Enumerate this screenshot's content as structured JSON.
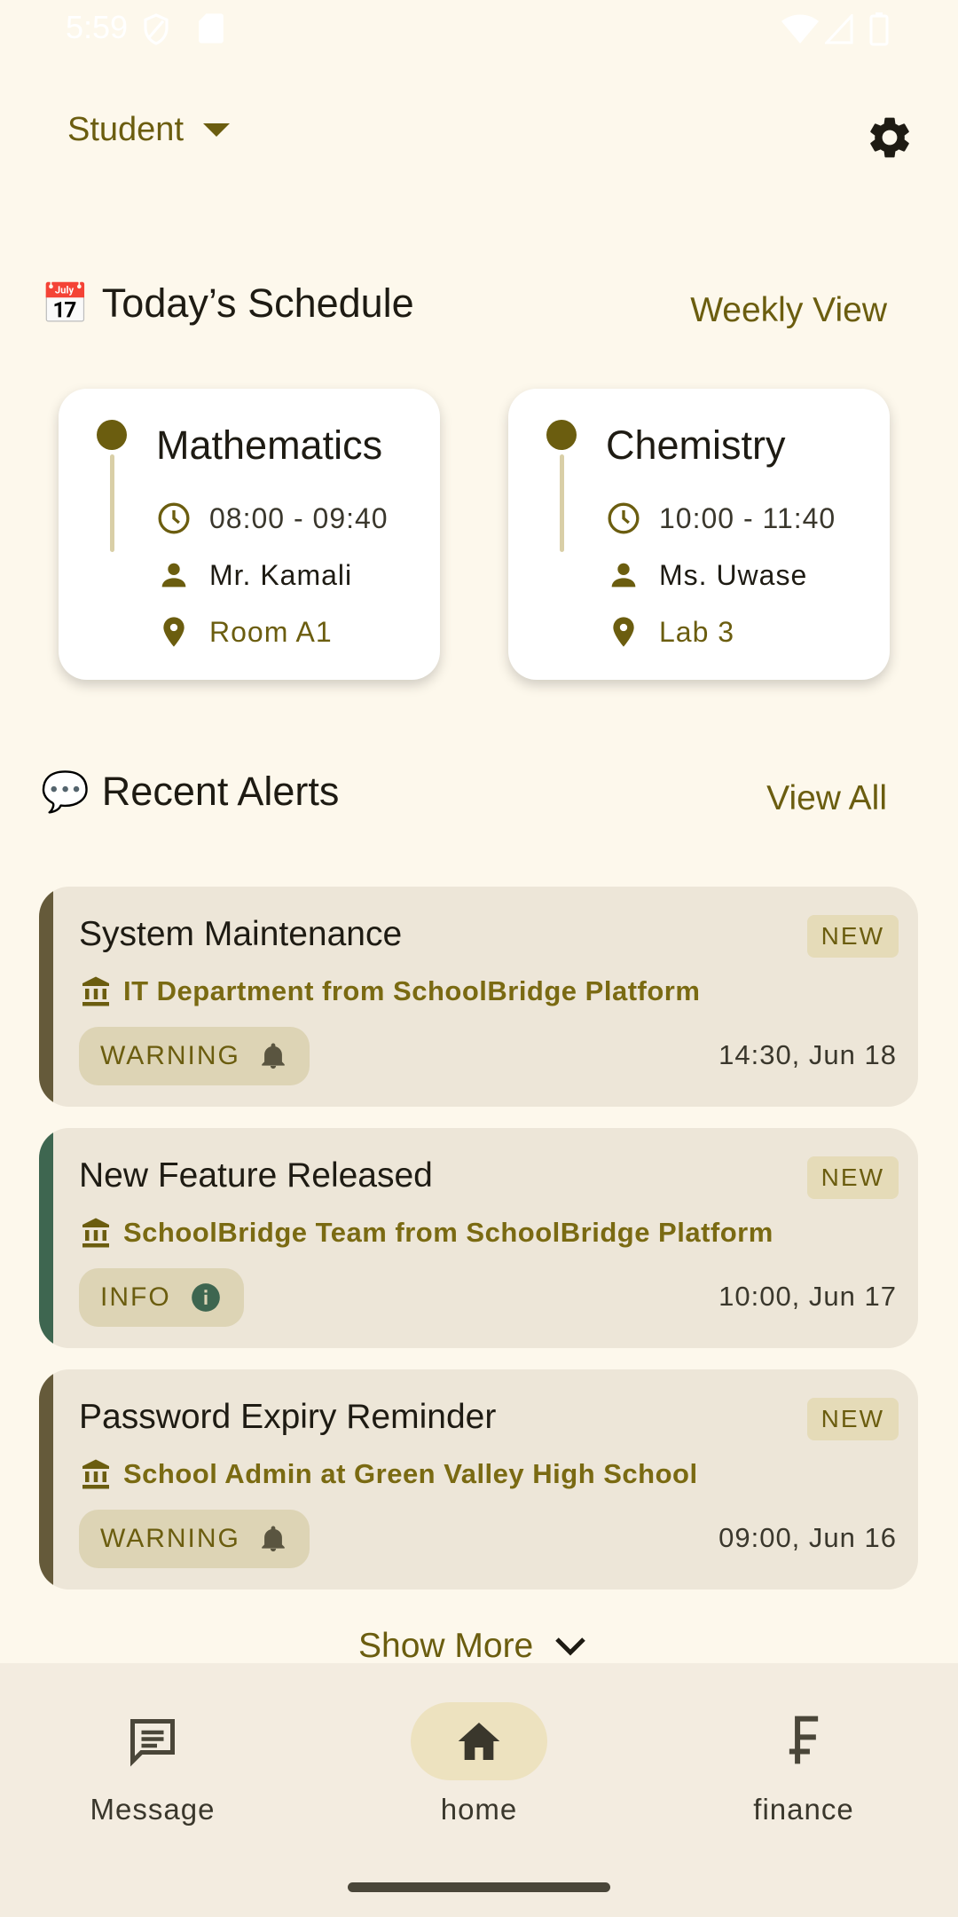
{
  "status_bar": {
    "time": "5:59"
  },
  "header": {
    "role": "Student"
  },
  "schedule": {
    "title": "Today’s Schedule",
    "link": "Weekly View",
    "emoji": "📅",
    "classes": [
      {
        "subject": "Mathematics",
        "time": "08:00 - 09:40",
        "teacher": "Mr. Kamali",
        "room": "Room A1"
      },
      {
        "subject": "Chemistry",
        "time": "10:00 - 11:40",
        "teacher": "Ms. Uwase",
        "room": "Lab 3"
      }
    ]
  },
  "alerts": {
    "title": "Recent Alerts",
    "link": "View All",
    "emoji": "💬",
    "items": [
      {
        "title": "System Maintenance",
        "badge": "NEW",
        "source": "IT Department from SchoolBridge Platform",
        "type": "WARNING",
        "time": "14:30, Jun 18",
        "accent": "#655a3a"
      },
      {
        "title": "New Feature Released",
        "badge": "NEW",
        "source": "SchoolBridge Team from SchoolBridge Platform",
        "type": "INFO",
        "time": "10:00, Jun 17",
        "accent": "#3e6650"
      },
      {
        "title": "Password Expiry Reminder",
        "badge": "NEW",
        "source": "School Admin at Green Valley High School",
        "type": "WARNING",
        "time": "09:00, Jun 16",
        "accent": "#655a3a"
      }
    ],
    "show_more": "Show More"
  },
  "bottom_nav": {
    "items": [
      {
        "label": "Message",
        "icon": "message-icon"
      },
      {
        "label": "home",
        "icon": "home-icon",
        "active": true
      },
      {
        "label": "finance",
        "icon": "finance-icon"
      }
    ]
  },
  "colors": {
    "accent": "#6b5d0f",
    "background": "#fdf8ec",
    "card": "#ede6d8",
    "info": "#3e6650",
    "warning": "#655a3a"
  }
}
